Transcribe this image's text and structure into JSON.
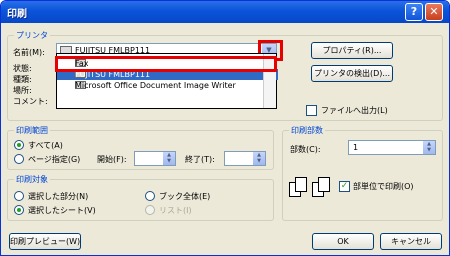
{
  "window": {
    "title": "印刷"
  },
  "printer_group": {
    "label": "プリンタ",
    "name_label": "名前(M):",
    "selected_printer": "FUJITSU FMLBP111",
    "status_label": "状態:",
    "type_label": "種類:",
    "where_label": "場所:",
    "comment_label": "コメント:",
    "properties_button": "プロパティ(R)...",
    "find_printer_button": "プリンタの検出(D)...",
    "print_to_file_label": "ファイルへ出力(L)",
    "dropdown_options": [
      "Fax",
      "FUJITSU FMLBP111",
      "Microsoft Office Document Image Writer"
    ]
  },
  "range_group": {
    "label": "印刷範囲",
    "all_label": "すべて(A)",
    "pages_label": "ページ指定(G)",
    "from_label": "開始(F):",
    "to_label": "終了(T):"
  },
  "copies_group": {
    "label": "印刷部数",
    "copies_label": "部数(C):",
    "copies_value": "1",
    "collate_label": "部単位で印刷(O)"
  },
  "target_group": {
    "label": "印刷対象",
    "selection_label": "選択した部分(N)",
    "sheet_label": "選択したシート(V)",
    "workbook_label": "ブック全体(E)",
    "list_label": "リスト(I)"
  },
  "footer": {
    "preview_button": "印刷プレビュー(W)",
    "ok_button": "OK",
    "cancel_button": "キャンセル"
  }
}
